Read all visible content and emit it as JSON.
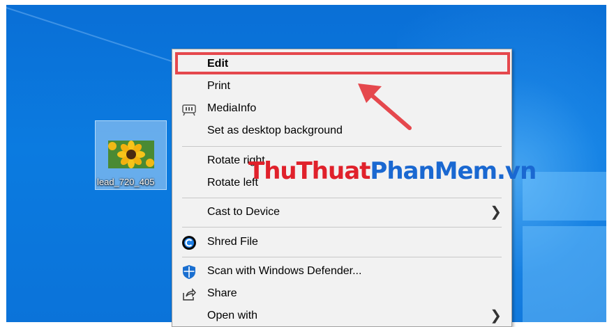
{
  "desktop": {
    "icon_label": "lead_720_405",
    "icon_name": "image-file-icon"
  },
  "context_menu": {
    "items": [
      {
        "label": "Edit",
        "bold": true
      },
      {
        "label": "Print"
      },
      {
        "label": "MediaInfo",
        "icon": "mediainfo-icon"
      },
      {
        "label": "Set as desktop background"
      },
      {
        "label": "Rotate right"
      },
      {
        "label": "Rotate left"
      },
      {
        "label": "Cast to Device",
        "submenu": true
      },
      {
        "label": "Shred File",
        "icon": "shred-icon"
      },
      {
        "label": "Scan with Windows Defender...",
        "icon": "defender-shield-icon"
      },
      {
        "label": "Share",
        "icon": "share-icon"
      },
      {
        "label": "Open with",
        "submenu": true
      }
    ],
    "submenu_glyph": "❯"
  },
  "watermark": {
    "part1": "ThuThuat",
    "part2": "PhanMem",
    "part3": ".vn"
  },
  "annotation": {
    "highlight_color": "#e5484d"
  }
}
